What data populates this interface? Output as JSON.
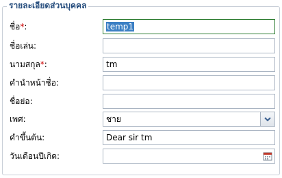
{
  "section": {
    "title": "รายละเอียดส่วนบุคคล"
  },
  "fields": [
    {
      "label": "ชื่อ",
      "required": "*",
      "value": "temp1"
    },
    {
      "label": "ชื่อเล่น:",
      "value": ""
    },
    {
      "label": "นามสกุล",
      "required": "*",
      "value": "tm"
    },
    {
      "label": "คำนำหน้าชื่อ:",
      "value": ""
    },
    {
      "label": "ชื่อย่อ:",
      "value": ""
    },
    {
      "label": "เพศ:",
      "value": "ชาย"
    },
    {
      "label": "คำขึ้นต้น:",
      "value": "Dear sir tm"
    },
    {
      "label": "วันเดือนปีเกิด:",
      "value": ""
    }
  ],
  "icons": {
    "combo": "chevron-down-icon",
    "date": "calendar-icon"
  }
}
